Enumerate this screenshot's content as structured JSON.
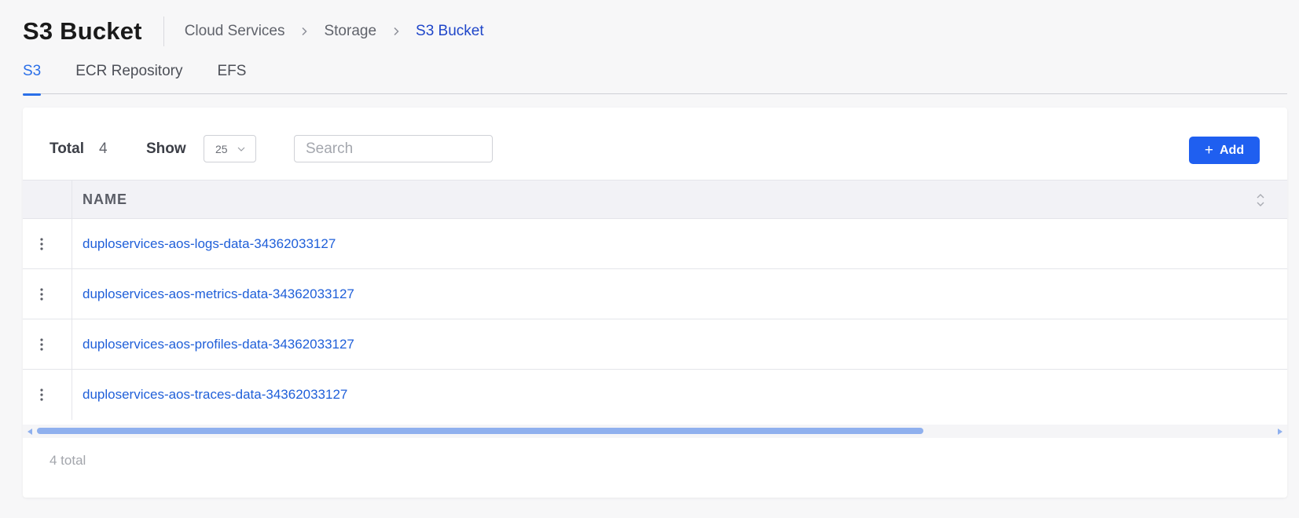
{
  "header": {
    "title": "S3 Bucket",
    "breadcrumb": [
      "Cloud Services",
      "Storage",
      "S3 Bucket"
    ]
  },
  "tabs": [
    {
      "label": "S3",
      "active": true
    },
    {
      "label": "ECR Repository",
      "active": false
    },
    {
      "label": "EFS",
      "active": false
    }
  ],
  "toolbar": {
    "total_label": "Total",
    "total_value": "4",
    "show_label": "Show",
    "page_size": "25",
    "search_placeholder": "Search",
    "add_label": "Add"
  },
  "table": {
    "columns": [
      "NAME"
    ],
    "rows": [
      {
        "name": "duploservices-aos-logs-data-34362033127"
      },
      {
        "name": "duploservices-aos-metrics-data-34362033127"
      },
      {
        "name": "duploservices-aos-profiles-data-34362033127"
      },
      {
        "name": "duploservices-aos-traces-data-34362033127"
      }
    ]
  },
  "footer": {
    "total_text": "4 total"
  },
  "colors": {
    "accent": "#1f5ff0",
    "link": "#1f5fd9",
    "breadcrumb_current": "#1f46c9"
  }
}
